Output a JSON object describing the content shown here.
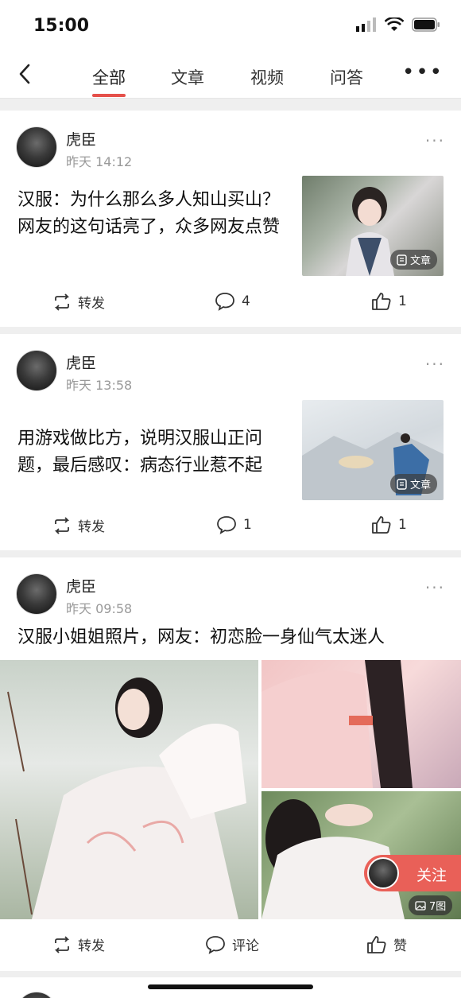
{
  "status": {
    "time": "15:00"
  },
  "nav": {
    "tabs": [
      "全部",
      "文章",
      "视频",
      "问答"
    ],
    "active_tab": "全部"
  },
  "posts": [
    {
      "author": "虎臣",
      "time": "昨天 14:12",
      "title": "汉服：为什么那么多人知山买山？网友的这句话亮了，众多网友点赞",
      "badge": "文章",
      "actions": {
        "repost": "转发",
        "comments": "4",
        "likes": "1"
      }
    },
    {
      "author": "虎臣",
      "time": "昨天 13:58",
      "title": "用游戏做比方，说明汉服山正问题，最后感叹：病态行业惹不起",
      "badge": "文章",
      "actions": {
        "repost": "转发",
        "comments": "1",
        "likes": "1"
      }
    },
    {
      "author": "虎臣",
      "time": "昨天 09:58",
      "title": "汉服小姐姐照片，网友：初恋脸一身仙气太迷人",
      "image_count": "7图",
      "follow": "关注",
      "actions": {
        "repost": "转发",
        "comments": "评论",
        "likes": "赞"
      }
    }
  ],
  "colors": {
    "accent": "#e5504a",
    "follow_bg": "#e96058"
  }
}
